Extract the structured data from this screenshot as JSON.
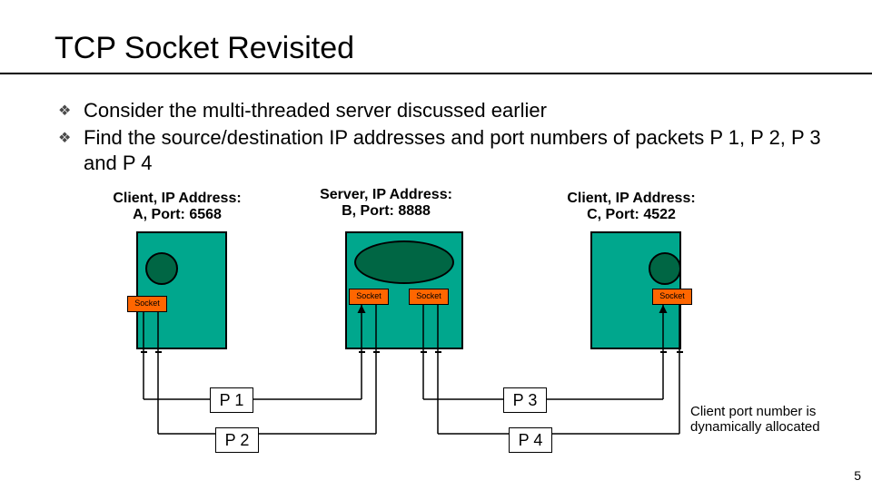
{
  "title": "TCP Socket Revisited",
  "bullets": [
    "Consider the multi-threaded server discussed earlier",
    "Find the source/destination IP addresses and port numbers of packets P 1, P 2, P 3 and P 4"
  ],
  "nodes": {
    "clientA": {
      "line1": "Client, IP Address:",
      "line2": "A, Port: 6568"
    },
    "server": {
      "line1": "Server, IP Address:",
      "line2": "B, Port: 8888"
    },
    "clientC": {
      "line1": "Client, IP Address:",
      "line2": "C, Port: 4522"
    }
  },
  "socket_label": "Socket",
  "packets": {
    "p1": "P 1",
    "p2": "P 2",
    "p3": "P 3",
    "p4": "P 4"
  },
  "note": "Client port number is dynamically allocated",
  "page_number": "5",
  "colors": {
    "host": "#00a78d",
    "server_shape": "#006644",
    "socket": "#ff6600"
  }
}
